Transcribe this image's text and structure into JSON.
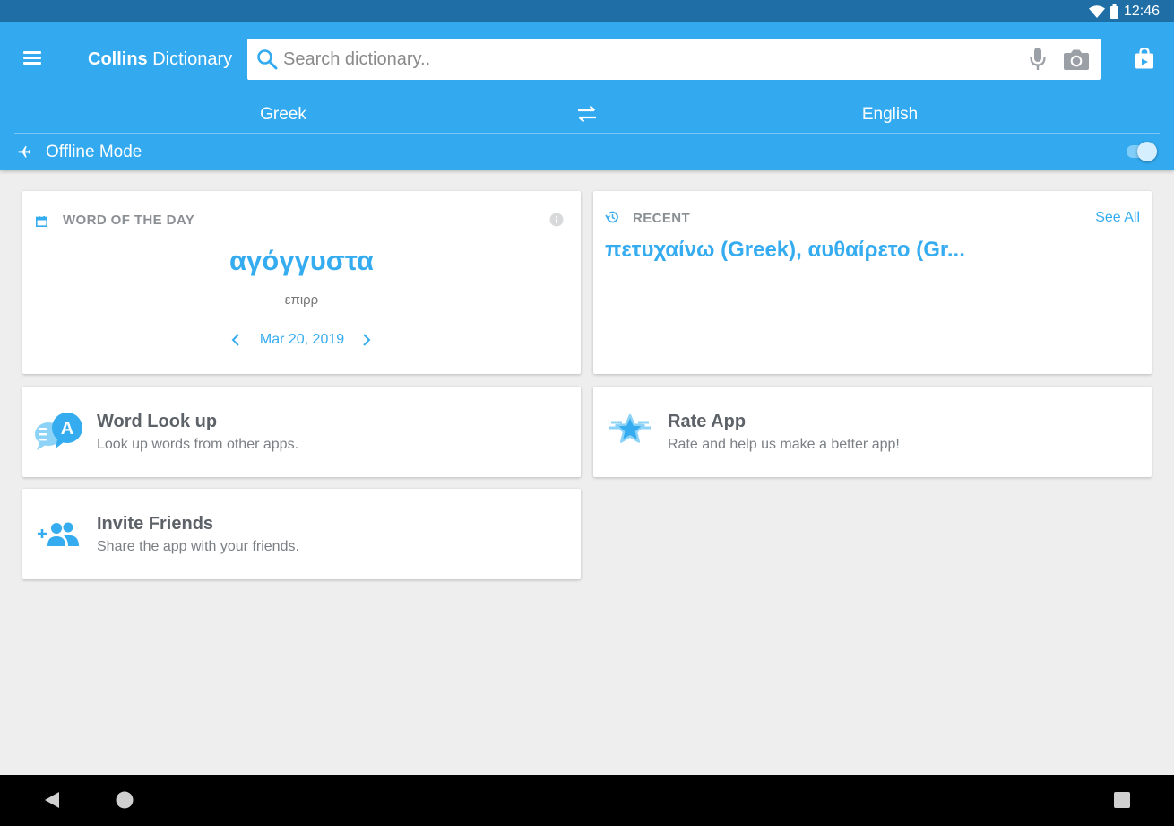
{
  "status_bar": {
    "time": "12:46"
  },
  "app_bar": {
    "title_bold": "Collins",
    "title_rest": " Dictionary",
    "search_placeholder": "Search dictionary..",
    "search_value": ""
  },
  "languages": {
    "from": "Greek",
    "to": "English"
  },
  "offline": {
    "label": "Offline Mode",
    "enabled": true
  },
  "word_of_day": {
    "header": "WORD OF THE DAY",
    "word": "αγόγγυστα",
    "part_of_speech": "επιρρ",
    "date": "Mar 20, 2019"
  },
  "recent": {
    "header": "RECENT",
    "see_all": "See All",
    "items_text": "πετυχαίνω (Greek), αυθαίρετο (Gr..."
  },
  "features": [
    {
      "title": "Word Look up",
      "subtitle": "Look up words from other apps.",
      "icon": "word-lookup-icon"
    },
    {
      "title": "Rate App",
      "subtitle": "Rate and help us make a better app!",
      "icon": "star-icon"
    },
    {
      "title": "Invite Friends",
      "subtitle": "Share the app with your friends.",
      "icon": "add-people-icon"
    }
  ],
  "colors": {
    "app_bar": "#33aaf0",
    "status_bar": "#1f6fa6",
    "accent": "#35acf0",
    "background": "#eeeeee"
  }
}
